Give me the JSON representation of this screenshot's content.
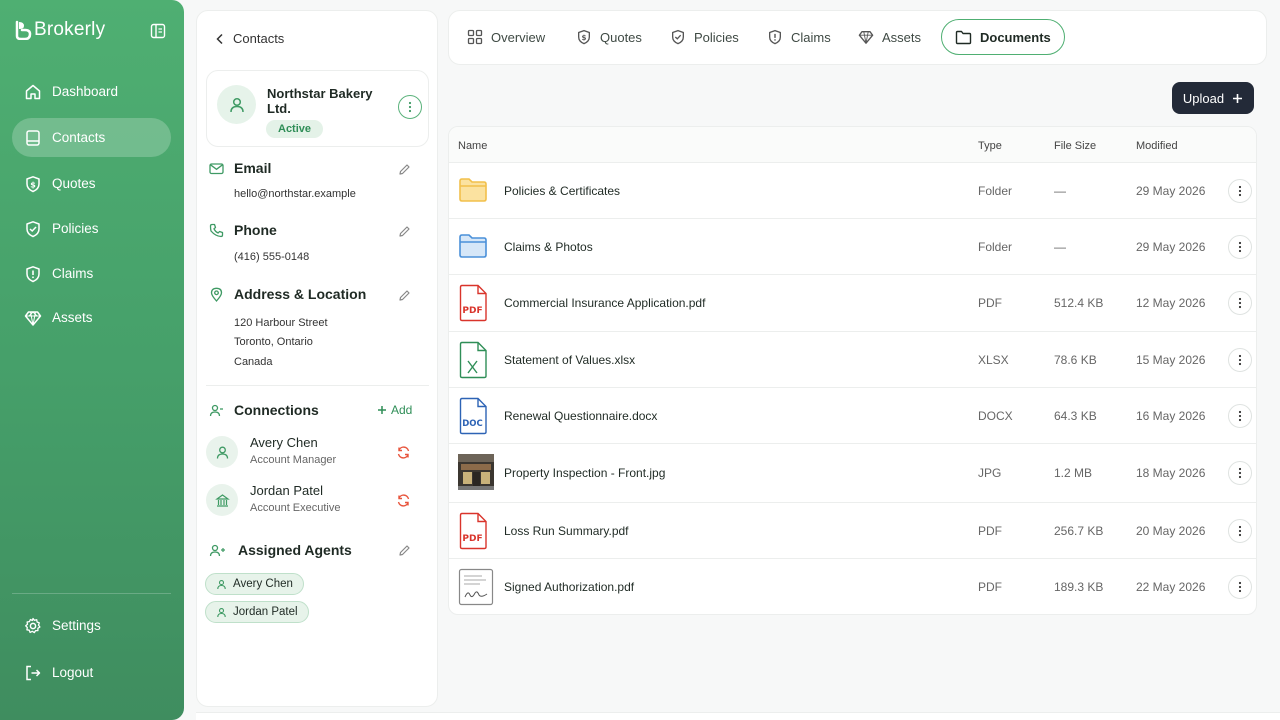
{
  "app": {
    "name": "Brokerly"
  },
  "nav": {
    "items": [
      {
        "label": "Dashboard",
        "icon": "home-icon"
      },
      {
        "label": "Contacts",
        "icon": "contact-book-icon"
      },
      {
        "label": "Quotes",
        "icon": "dollar-shield-icon"
      },
      {
        "label": "Policies",
        "icon": "shield-check-icon"
      },
      {
        "label": "Claims",
        "icon": "shield-alert-icon"
      },
      {
        "label": "Assets",
        "icon": "diamond-icon"
      }
    ],
    "active": "Contacts",
    "settings_label": "Settings",
    "logout_label": "Logout"
  },
  "contact": {
    "back_label": "Contacts",
    "name": "Northstar Bakery Ltd.",
    "status": "Active",
    "email": {
      "title": "Email",
      "value": "hello@northstar.example"
    },
    "phone": {
      "title": "Phone",
      "value": "(416) 555-0148"
    },
    "address": {
      "title": "Address & Location",
      "line1": "120 Harbour Street",
      "line2": "Toronto, Ontario",
      "line3": "Canada"
    },
    "connections": {
      "title": "Connections",
      "add_label": "Add",
      "people": [
        {
          "name": "Avery Chen",
          "role": "Account Manager"
        },
        {
          "name": "Jordan Patel",
          "role": "Account Executive"
        }
      ]
    },
    "agents": {
      "title": "Assigned Agents",
      "people": [
        "Avery Chen",
        "Jordan Patel"
      ]
    }
  },
  "tabs": [
    {
      "label": "Overview",
      "icon": "grid-icon"
    },
    {
      "label": "Quotes",
      "icon": "dollar-shield-icon"
    },
    {
      "label": "Policies",
      "icon": "shield-check-icon"
    },
    {
      "label": "Claims",
      "icon": "shield-alert-icon"
    },
    {
      "label": "Assets",
      "icon": "diamond-icon"
    },
    {
      "label": "Documents",
      "icon": "folder-icon"
    }
  ],
  "active_tab": "Documents",
  "upload_label": "Upload",
  "table": {
    "columns": [
      "Name",
      "Type",
      "File Size",
      "Modified"
    ],
    "rows": [
      {
        "name": "Policies & Certificates",
        "type": "Folder",
        "size": "—",
        "modified": "29 May 2026",
        "icon": "folder-yellow-icon",
        "accent": "#f2c04b"
      },
      {
        "name": "Claims & Photos",
        "type": "Folder",
        "size": "—",
        "modified": "29 May 2026",
        "icon": "folder-blue-icon",
        "accent": "#4a90d9"
      },
      {
        "name": "Commercial Insurance Application.pdf",
        "type": "PDF",
        "size": "512.4 KB",
        "modified": "12 May 2026",
        "icon": "pdf-file-icon",
        "accent": "#d9342b"
      },
      {
        "name": "Statement of Values.xlsx",
        "type": "XLSX",
        "size": "78.6 KB",
        "modified": "15 May 2026",
        "icon": "xlsx-file-icon",
        "accent": "#2f8e57"
      },
      {
        "name": "Renewal Questionnaire.docx",
        "type": "DOCX",
        "size": "64.3 KB",
        "modified": "16 May 2026",
        "icon": "docx-file-icon",
        "accent": "#2d63b5"
      },
      {
        "name": "Property Inspection - Front.jpg",
        "type": "JPG",
        "size": "1.2 MB",
        "modified": "18 May 2026",
        "icon": "image-thumbnail-icon",
        "accent": "#5a4a3c"
      },
      {
        "name": "Loss Run Summary.pdf",
        "type": "PDF",
        "size": "256.7 KB",
        "modified": "20 May 2026",
        "icon": "pdf-file-icon",
        "accent": "#d9342b"
      },
      {
        "name": "Signed Authorization.pdf",
        "type": "PDF",
        "size": "189.3 KB",
        "modified": "22 May 2026",
        "icon": "signed-document-icon",
        "accent": "#555555"
      }
    ]
  },
  "colors": {
    "brand": "#4faf72",
    "brand_dark": "#3f8d5f",
    "upload_bg": "#232a38",
    "pdf": "#d9342b",
    "xlsx": "#2f8e57",
    "docx": "#2d63b5",
    "sync": "#e8553d"
  }
}
